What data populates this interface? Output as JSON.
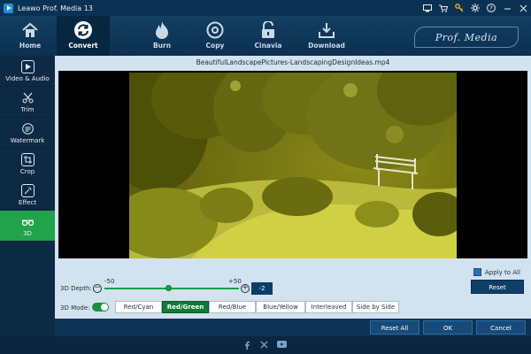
{
  "app": {
    "title": "Leawo Prof. Media 13"
  },
  "toolbar": {
    "items": [
      {
        "label": "Home",
        "icon": "home-icon"
      },
      {
        "label": "Convert",
        "icon": "convert-icon"
      },
      {
        "label": "Burn",
        "icon": "burn-icon"
      },
      {
        "label": "Copy",
        "icon": "copy-icon"
      },
      {
        "label": "Cinavia",
        "icon": "cinavia-icon"
      },
      {
        "label": "Download",
        "icon": "download-icon"
      }
    ],
    "active": "Convert",
    "brand": "Prof. Media"
  },
  "sidebar": {
    "items": [
      {
        "label": "Video & Audio",
        "icon": "video-audio-icon"
      },
      {
        "label": "Trim",
        "icon": "trim-icon"
      },
      {
        "label": "Watermark",
        "icon": "watermark-icon"
      },
      {
        "label": "Crop",
        "icon": "crop-icon"
      },
      {
        "label": "Effect",
        "icon": "effect-icon"
      },
      {
        "label": "3D",
        "icon": "3d-glasses-icon"
      }
    ],
    "active": "3D"
  },
  "editor": {
    "filename": "BeautifulLandscapePictures-LandscapingDesignIdeas.mp4",
    "depth": {
      "label": "3D Depth:",
      "min_label": "-50",
      "max_label": "+50",
      "value": "-2"
    },
    "apply_to_all_label": "Apply to All",
    "apply_to_all_checked": true,
    "reset_label": "Reset",
    "mode": {
      "label": "3D Mode:",
      "enabled": true,
      "options": [
        "Red/Cyan",
        "Red/Green",
        "Red/Blue",
        "Blue/Yellow",
        "Interleaved",
        "Side by Side"
      ],
      "selected": "Red/Green"
    }
  },
  "footer": {
    "reset_all_label": "Reset All",
    "ok_label": "OK",
    "cancel_label": "Cancel",
    "social": [
      "facebook-icon",
      "x-icon",
      "youtube-icon"
    ]
  },
  "colors": {
    "accent_green": "#20a34a",
    "navy": "#0d2a45",
    "panel": "#d3e2ef"
  }
}
